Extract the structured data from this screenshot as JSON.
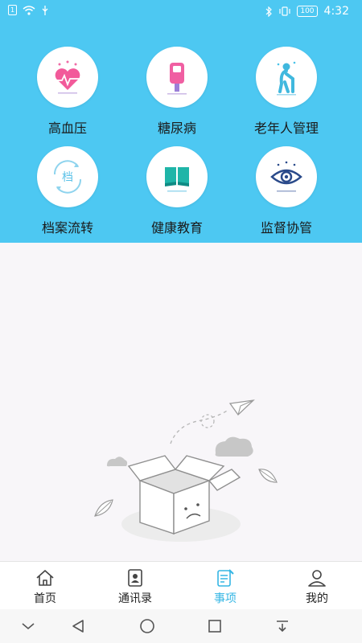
{
  "status_bar": {
    "time": "4:32",
    "battery": "100"
  },
  "features": [
    {
      "label": "高血压",
      "icon": "heart-pulse-icon"
    },
    {
      "label": "糖尿病",
      "icon": "glucose-meter-icon"
    },
    {
      "label": "老年人管理",
      "icon": "elderly-person-icon"
    },
    {
      "label": "档案流转",
      "icon": "archive-transfer-icon",
      "glyph": "档"
    },
    {
      "label": "健康教育",
      "icon": "open-book-icon"
    },
    {
      "label": "监督协管",
      "icon": "eye-icon"
    }
  ],
  "tabs": [
    {
      "label": "首页",
      "icon": "home-icon",
      "active": false
    },
    {
      "label": "通讯录",
      "icon": "contacts-icon",
      "active": false
    },
    {
      "label": "事项",
      "icon": "tasks-icon",
      "active": true
    },
    {
      "label": "我的",
      "icon": "user-icon",
      "active": false
    }
  ],
  "colors": {
    "header": "#4dc8f2",
    "accent": "#35b6e4",
    "background": "#f8f6f9"
  }
}
